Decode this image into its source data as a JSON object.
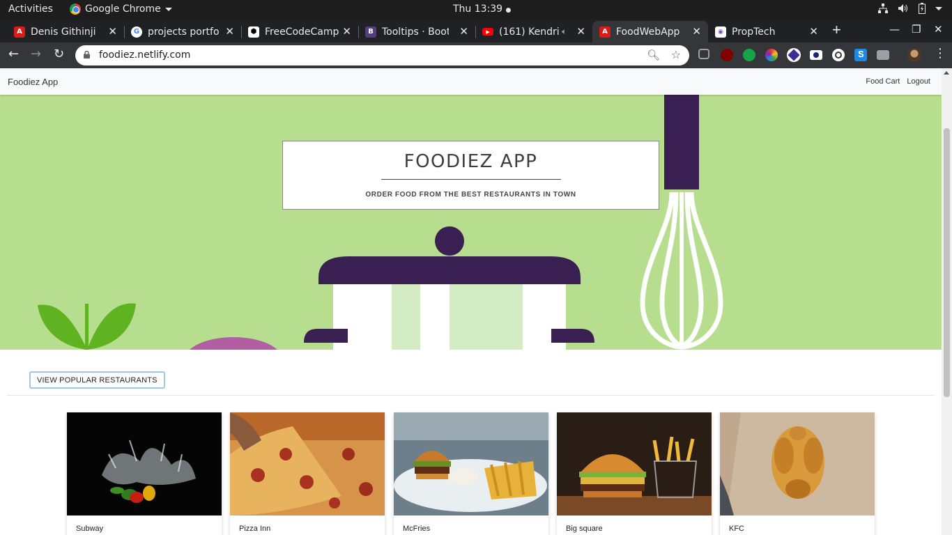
{
  "system_bar": {
    "activities": "Activities",
    "app_name": "Google Chrome",
    "clock": "Thu 13:39"
  },
  "browser": {
    "tabs": [
      {
        "label": "Denis Githinji",
        "favicon": "angular-icon",
        "color": "#dd1b16"
      },
      {
        "label": "projects portfo",
        "favicon": "google-icon",
        "color": "#ffffff"
      },
      {
        "label": "FreeCodeCamp",
        "favicon": "freecodecamp-icon",
        "color": "#ffffff"
      },
      {
        "label": "Tooltips · Boots",
        "favicon": "bootstrap-icon",
        "color": "#563d7c"
      },
      {
        "label": "(161) Kendri",
        "favicon": "youtube-icon",
        "color": "#ff0000"
      },
      {
        "label": "FoodWebApp",
        "favicon": "angular-icon",
        "color": "#dd1b16",
        "active": true
      },
      {
        "label": "PropTech",
        "favicon": "proptech-icon",
        "color": "#ffffff"
      }
    ],
    "url": "foodiez.netlify.com"
  },
  "navbar": {
    "brand": "Foodiez App",
    "links": [
      "Food Cart",
      "Logout"
    ]
  },
  "hero": {
    "title": "FOODIEZ APP",
    "subtitle": "ORDER FOOD FROM THE BEST RESTAURANTS IN TOWN",
    "background_color": "#b7de8e",
    "accent_color": "#3a1f52"
  },
  "actions": {
    "view_popular": "VIEW POPULAR RESTAURANTS"
  },
  "restaurants": [
    {
      "name": "Subway",
      "image": "vegetables-splash-photo"
    },
    {
      "name": "Pizza Inn",
      "image": "pizza-photo"
    },
    {
      "name": "McFries",
      "image": "burger-and-fries-plate-photo"
    },
    {
      "name": "Big square",
      "image": "burger-on-board-photo"
    },
    {
      "name": "KFC",
      "image": "roast-chicken-photo"
    }
  ]
}
